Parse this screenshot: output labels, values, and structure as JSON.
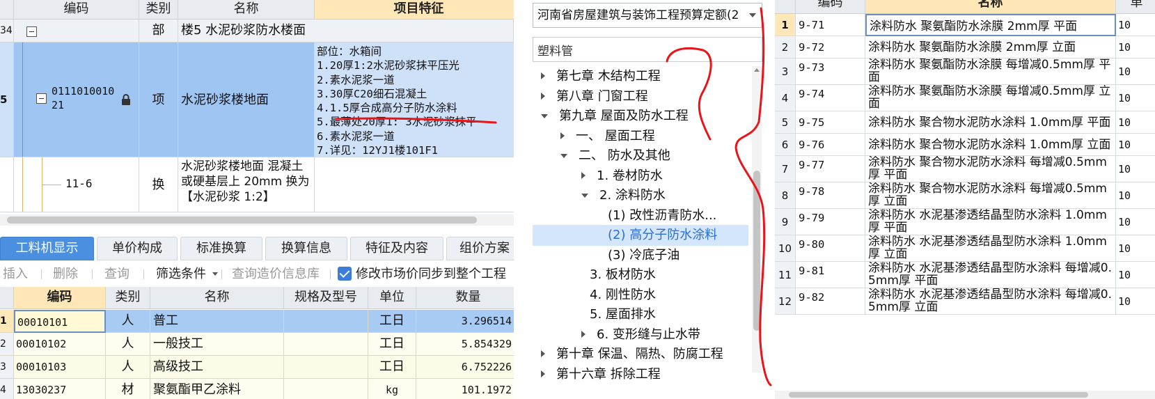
{
  "left_top_grid": {
    "headers": {
      "code": "编码",
      "type": "类别",
      "name": "名称",
      "features": "项目特征"
    },
    "rows": [
      {
        "rownum": "34",
        "code": "",
        "type": "部",
        "name": "楼5 水泥砂浆防水楼面",
        "features": []
      },
      {
        "rownum": "5",
        "code_line1": "0111010010",
        "code_line2": "21",
        "type": "项",
        "name": "水泥砂浆楼地面",
        "features": [
          "部位：水箱间",
          "1.20厚1:2水泥砂浆抹平压光",
          "2.素水泥浆一道",
          "3.30厚C20细石混凝土",
          "4.1.5厚合成高分子防水涂料",
          "5.最薄处20厚1: 3水泥砂浆抹平",
          "6.素水泥浆一道",
          "7.详见：12YJ1楼101F1"
        ]
      },
      {
        "rownum": "",
        "code": "11-6",
        "type": "换",
        "name_lines": [
          "水泥砂浆楼地面 混凝土",
          "或硬基层上 20mm  换为",
          "【水泥砂浆 1:2】"
        ],
        "features": []
      }
    ]
  },
  "tabs": [
    "工料机显示",
    "单价构成",
    "标准换算",
    "换算信息",
    "特征及内容",
    "组价方案"
  ],
  "toolbar": {
    "insert": "插入",
    "delete": "删除",
    "query": "查询",
    "filter": "筛选条件",
    "query_price_db": "查询造价信息库",
    "sync_checkbox_label": "修改市场价同步到整个工程"
  },
  "left_bottom_grid": {
    "headers": {
      "code": "编码",
      "type": "类别",
      "name": "名称",
      "spec": "规格及型号",
      "unit": "单位",
      "qty": "数量"
    },
    "rows": [
      {
        "rownum": "1",
        "code": "00010101",
        "type": "人",
        "name": "普工",
        "spec": "",
        "unit": "工日",
        "qty": "3.296514"
      },
      {
        "rownum": "2",
        "code": "00010102",
        "type": "人",
        "name": "一般技工",
        "spec": "",
        "unit": "工日",
        "qty": "5.854329"
      },
      {
        "rownum": "3",
        "code": "00010103",
        "type": "人",
        "name": "高级技工",
        "spec": "",
        "unit": "工日",
        "qty": "6.752226"
      },
      {
        "rownum": "4",
        "code": "13030237",
        "type": "材",
        "name": "聚氨酯甲乙涂料",
        "spec": "",
        "unit": "kg",
        "qty": "101.1972"
      }
    ]
  },
  "middle": {
    "quota_library": "河南省房屋建筑与装饰工程预算定额(2",
    "search_value": "塑料管",
    "tree": [
      {
        "label": "第七章 木结构工程",
        "depth": 0,
        "toggle": "collapsed"
      },
      {
        "label": "第八章 门窗工程",
        "depth": 0,
        "toggle": "collapsed"
      },
      {
        "label": "第九章 屋面及防水工程",
        "depth": 0,
        "toggle": "expanded"
      },
      {
        "label": "一、 屋面工程",
        "depth": 1,
        "toggle": "collapsed"
      },
      {
        "label": "二、 防水及其他",
        "depth": 1,
        "toggle": "expanded"
      },
      {
        "label": "1. 卷材防水",
        "depth": 2,
        "toggle": "collapsed"
      },
      {
        "label": "2. 涂料防水",
        "depth": 2,
        "toggle": "expanded"
      },
      {
        "label": "(1) 改性沥青防水...",
        "depth": 3,
        "toggle": "none"
      },
      {
        "label": "(2) 高分子防水涂料",
        "depth": 3,
        "toggle": "none",
        "selected": true
      },
      {
        "label": "(3) 冷底子油",
        "depth": 3,
        "toggle": "none"
      },
      {
        "label": "3. 板材防水",
        "depth": 2,
        "toggle": "none"
      },
      {
        "label": "4. 刚性防水",
        "depth": 2,
        "toggle": "none"
      },
      {
        "label": "5. 屋面排水",
        "depth": 2,
        "toggle": "none"
      },
      {
        "label": "6. 变形缝与止水带",
        "depth": 2,
        "toggle": "collapsed"
      },
      {
        "label": "第十章 保温、隔热、防腐工程",
        "depth": 0,
        "toggle": "collapsed"
      },
      {
        "label": "第十六章 拆除工程",
        "depth": 0,
        "toggle": "collapsed"
      }
    ]
  },
  "right_grid": {
    "headers": {
      "code": "编码",
      "name": "名称",
      "unit": "单"
    },
    "rows": [
      {
        "rownum": "1",
        "code": "9-71",
        "name": "涂料防水 聚氨酯防水涂膜 2mm厚 平面",
        "extra": "10"
      },
      {
        "rownum": "2",
        "code": "9-72",
        "name": "涂料防水 聚氨酯防水涂膜 2mm厚 立面",
        "extra": "10"
      },
      {
        "rownum": "3",
        "code": "9-73",
        "name": "涂料防水 聚氨酯防水涂膜 每增减0.5mm厚 平面",
        "extra": "10"
      },
      {
        "rownum": "4",
        "code": "9-74",
        "name": "涂料防水 聚氨酯防水涂膜 每增减0.5mm厚 立面",
        "extra": "10"
      },
      {
        "rownum": "5",
        "code": "9-75",
        "name": "涂料防水 聚合物水泥防水涂料 1.0mm厚 平面",
        "extra": "10"
      },
      {
        "rownum": "6",
        "code": "9-76",
        "name": "涂料防水 聚合物水泥防水涂料 1.0mm厚 立面",
        "extra": "10"
      },
      {
        "rownum": "7",
        "code": "9-77",
        "name": "涂料防水 聚合物水泥防水涂料 每增减0.5mm厚 平面",
        "extra": "10"
      },
      {
        "rownum": "8",
        "code": "9-78",
        "name": "涂料防水 聚合物水泥防水涂料 每增减0.5mm厚 立面",
        "extra": "10"
      },
      {
        "rownum": "9",
        "code": "9-79",
        "name": "涂料防水 水泥基渗透结晶型防水涂料 1.0mm厚 平面",
        "extra": "10"
      },
      {
        "rownum": "10",
        "code": "9-80",
        "name": "涂料防水 水泥基渗透结晶型防水涂料 1.0mm厚 立面",
        "extra": "10"
      },
      {
        "rownum": "11",
        "code": "9-81",
        "name": "涂料防水 水泥基渗透结晶型防水涂料 每增减0.5mm厚 平面",
        "extra": "10"
      },
      {
        "rownum": "12",
        "code": "9-82",
        "name": "涂料防水 水泥基渗透结晶型防水涂料 每增减0.5mm厚 立面",
        "extra": "10"
      }
    ]
  },
  "colors": {
    "accent": "#4a8fe0",
    "selected_row": "#9fc5f3",
    "header_highlight": "#ffe7b8",
    "annotation": "#e8141a"
  }
}
